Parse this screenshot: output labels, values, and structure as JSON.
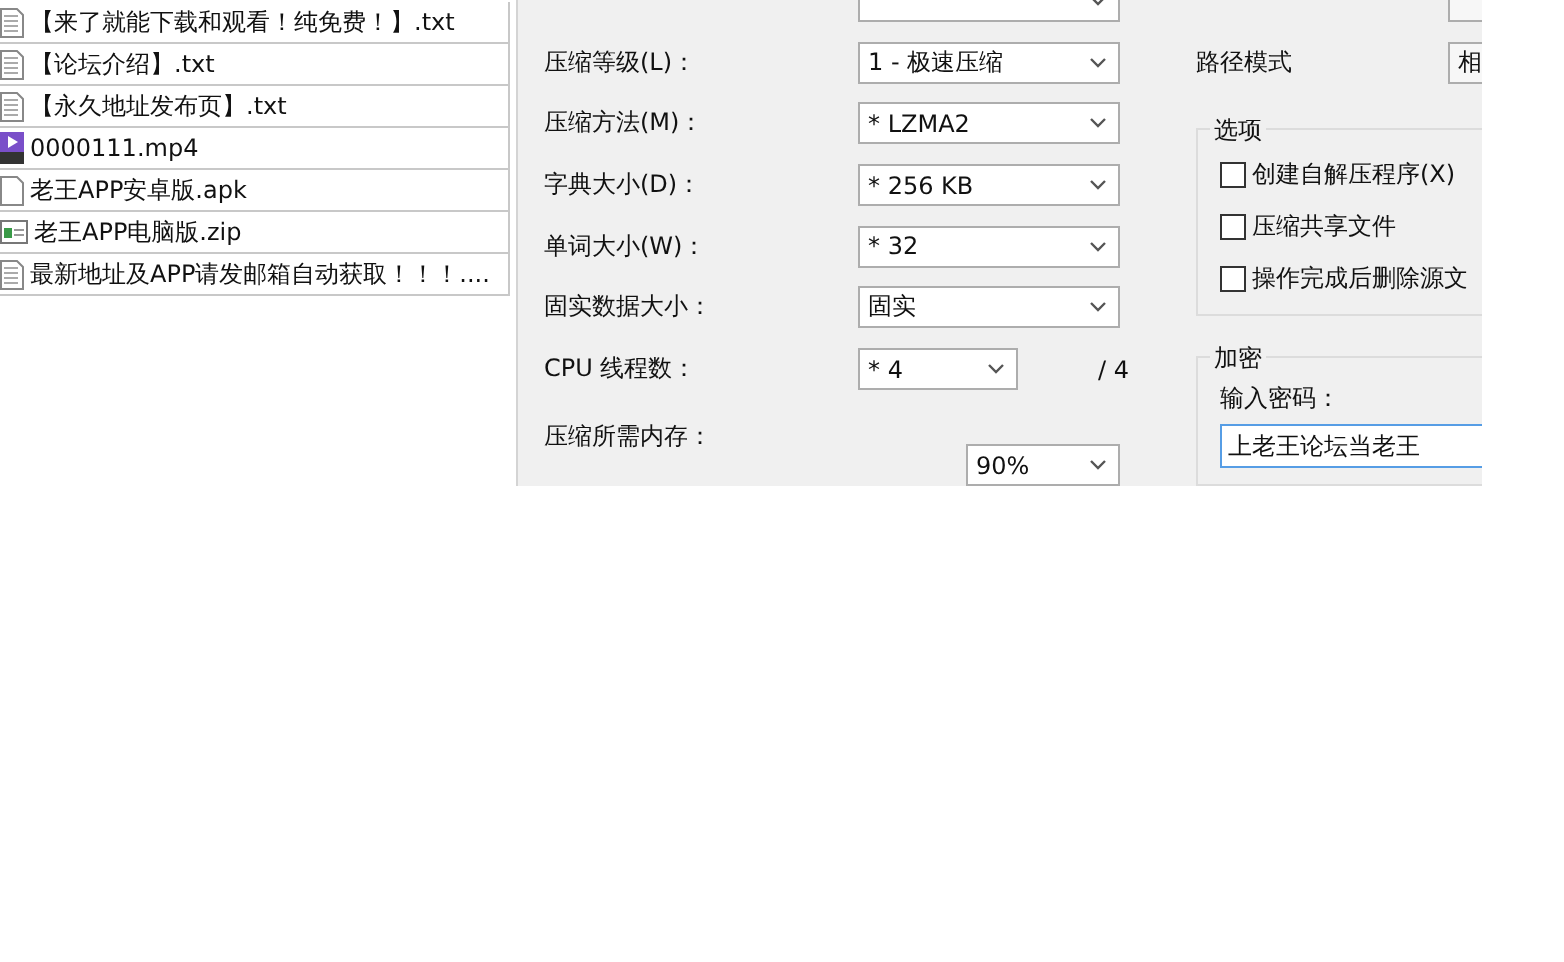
{
  "file_list": [
    {
      "name": "【来了就能下载和观看！纯免费！】.txt",
      "kind": "text"
    },
    {
      "name": "【论坛介绍】.txt",
      "kind": "text"
    },
    {
      "name": "【永久地址发布页】.txt",
      "kind": "text"
    },
    {
      "name": "0000111.mp4",
      "kind": "video"
    },
    {
      "name": "老王APP安卓版.apk",
      "kind": "blank"
    },
    {
      "name": "老王APP电脑版.zip",
      "kind": "archive"
    },
    {
      "name": "最新地址及APP请发邮箱自动获取！！！....",
      "kind": "text"
    }
  ],
  "compression_settings": [
    {
      "label": "压缩等级(L)：",
      "value": "1 - 极速压缩",
      "kind": "select"
    },
    {
      "label": "压缩方法(M)：",
      "value": "* LZMA2",
      "kind": "select"
    },
    {
      "label": "字典大小(D)：",
      "value": "* 256 KB",
      "kind": "select"
    },
    {
      "label": "单词大小(W)：",
      "value": "* 32",
      "kind": "select"
    },
    {
      "label": "固实数据大小：",
      "value": "固实",
      "kind": "select"
    },
    {
      "label": "CPU 线程数：",
      "value": "* 4",
      "kind": "short",
      "suffix": "/ 4"
    },
    {
      "label": "压缩所需内存：",
      "value": "90%",
      "kind": "offset"
    }
  ],
  "path_mode": {
    "label": "路径模式",
    "value": "相"
  },
  "options": {
    "title": "选项",
    "items": [
      {
        "label": "创建自解压程序(X)",
        "checked": false
      },
      {
        "label": "压缩共享文件",
        "checked": false
      },
      {
        "label": "操作完成后删除源文",
        "checked": false
      }
    ]
  },
  "encryption": {
    "title": "加密",
    "password_label": "输入密码：",
    "password_value": "上老王论坛当老王"
  }
}
